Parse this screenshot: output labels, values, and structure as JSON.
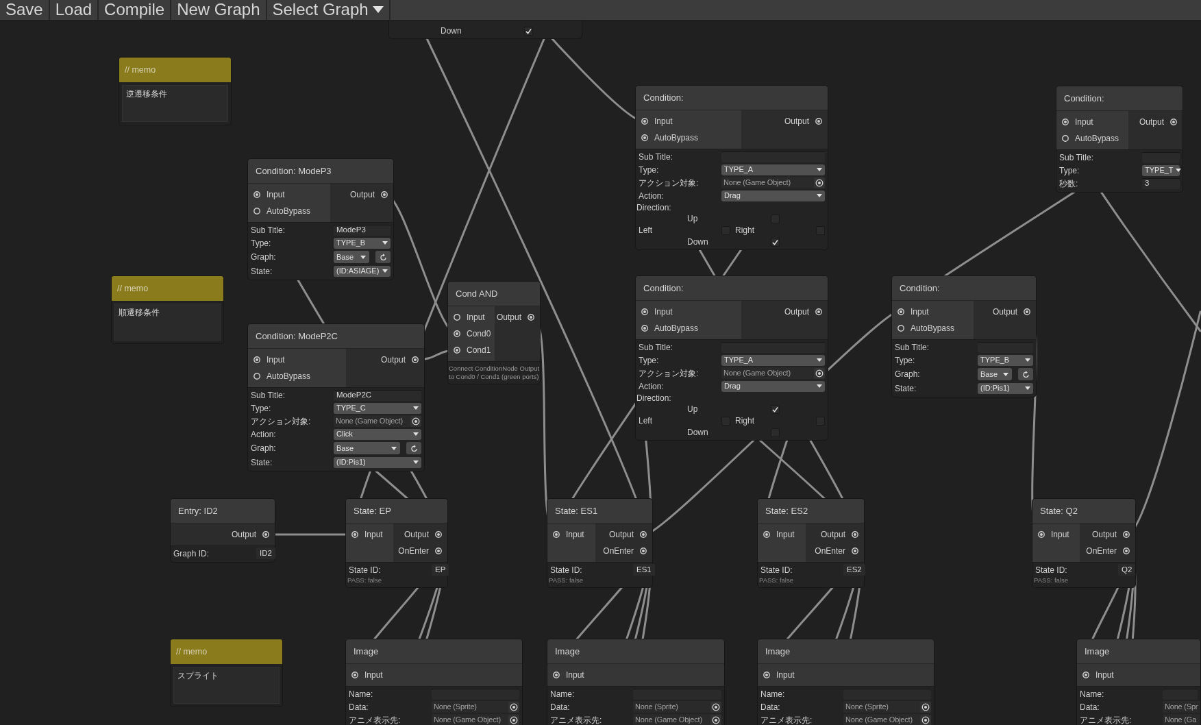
{
  "toolbar": {
    "buttons": [
      {
        "label": "Save",
        "kind": "button"
      },
      {
        "label": "Load",
        "kind": "button"
      },
      {
        "label": "Compile",
        "kind": "button"
      },
      {
        "label": "New Graph",
        "kind": "button"
      },
      {
        "label": "Select Graph",
        "kind": "dropdown"
      }
    ]
  },
  "nodes": [
    {
      "kind": "fragment",
      "fields": [
        {
          "kind": "check",
          "label": "Down",
          "checked": true
        }
      ]
    },
    {
      "kind": "memo",
      "title": "// memo",
      "text": "逆遷移条件"
    },
    {
      "kind": "node",
      "title": "Condition:",
      "inputs": [
        {
          "label": "Input",
          "connected": true
        },
        {
          "label": "AutoBypass",
          "connected": true
        }
      ],
      "outputs": [
        {
          "label": "Output",
          "connected": true
        }
      ],
      "fields": [
        {
          "kind": "text",
          "label": "Sub Title:"
        },
        {
          "kind": "dropdown",
          "label": "Type:",
          "value": "TYPE_A"
        },
        {
          "kind": "object",
          "label": "アクション対象:",
          "value": "None (Game Object)"
        },
        {
          "kind": "dropdown",
          "label": "Action:",
          "value": "Drag"
        },
        {
          "kind": "direction",
          "label": "Direction:",
          "options": [
            {
              "label": "Up",
              "checked": false
            },
            {
              "label": "Left",
              "checked": false
            },
            {
              "label": "Right",
              "checked": false
            },
            {
              "label": "Down",
              "checked": true
            }
          ]
        }
      ]
    },
    {
      "kind": "node",
      "title": "Condition:",
      "inputs": [
        {
          "label": "Input",
          "connected": true
        },
        {
          "label": "AutoBypass",
          "connected": false
        }
      ],
      "outputs": [
        {
          "label": "Output",
          "connected": true
        }
      ],
      "fields": [
        {
          "kind": "text",
          "label": "Sub Title:"
        },
        {
          "kind": "dropdown",
          "label": "Type:",
          "value": "TYPE_T"
        },
        {
          "kind": "text",
          "label": "秒数:",
          "value": "3"
        }
      ]
    },
    {
      "kind": "node",
      "title": "Condition: ModeP3",
      "inputs": [
        {
          "label": "Input",
          "connected": true
        },
        {
          "label": "AutoBypass",
          "connected": false
        }
      ],
      "outputs": [
        {
          "label": "Output",
          "connected": true
        }
      ],
      "fields": [
        {
          "kind": "text",
          "label": "Sub Title:",
          "value": "ModeP3"
        },
        {
          "kind": "dropdown",
          "label": "Type:",
          "value": "TYPE_B"
        },
        {
          "kind": "dropdown_reset",
          "label": "Graph:",
          "value": "Base"
        },
        {
          "kind": "dropdown",
          "label": "State:",
          "value": "(ID:ASIAGE)"
        }
      ]
    },
    {
      "kind": "memo",
      "title": "// memo",
      "text": "順遷移条件"
    },
    {
      "kind": "node",
      "title": "Cond AND",
      "inputs": [
        {
          "label": "Input",
          "connected": false
        },
        {
          "label": "Cond0",
          "connected": true
        },
        {
          "label": "Cond1",
          "connected": true
        }
      ],
      "outputs": [
        {
          "label": "Output",
          "connected": true
        }
      ],
      "note": [
        "Connect ConditionNode Output",
        "to Cond0 / Cond1 (green ports)"
      ]
    },
    {
      "kind": "node",
      "title": "Condition:",
      "inputs": [
        {
          "label": "Input",
          "connected": true
        },
        {
          "label": "AutoBypass",
          "connected": true
        }
      ],
      "outputs": [
        {
          "label": "Output",
          "connected": true
        }
      ],
      "fields": [
        {
          "kind": "text",
          "label": "Sub Title:"
        },
        {
          "kind": "dropdown",
          "label": "Type:",
          "value": "TYPE_A"
        },
        {
          "kind": "object",
          "label": "アクション対象:",
          "value": "None (Game Object)"
        },
        {
          "kind": "dropdown",
          "label": "Action:",
          "value": "Drag"
        },
        {
          "kind": "direction",
          "label": "Direction:",
          "options": [
            {
              "label": "Up",
              "checked": true
            },
            {
              "label": "Left",
              "checked": false
            },
            {
              "label": "Right",
              "checked": false
            },
            {
              "label": "Down",
              "checked": false
            }
          ]
        }
      ]
    },
    {
      "kind": "node",
      "title": "Condition:",
      "inputs": [
        {
          "label": "Input",
          "connected": true
        },
        {
          "label": "AutoBypass",
          "connected": false
        }
      ],
      "outputs": [
        {
          "label": "Output",
          "connected": true
        }
      ],
      "fields": [
        {
          "kind": "text",
          "label": "Sub Title:"
        },
        {
          "kind": "dropdown",
          "label": "Type:",
          "value": "TYPE_B"
        },
        {
          "kind": "dropdown_reset",
          "label": "Graph:",
          "value": "Base"
        },
        {
          "kind": "dropdown",
          "label": "State:",
          "value": "(ID:Pis1)"
        }
      ]
    },
    {
      "kind": "node",
      "title": "Condition: ModeP2C",
      "inputs": [
        {
          "label": "Input",
          "connected": true
        },
        {
          "label": "AutoBypass",
          "connected": false
        }
      ],
      "outputs": [
        {
          "label": "Output",
          "connected": true
        }
      ],
      "fields": [
        {
          "kind": "text",
          "label": "Sub Title:",
          "value": "ModeP2C"
        },
        {
          "kind": "dropdown",
          "label": "Type:",
          "value": "TYPE_C"
        },
        {
          "kind": "object",
          "label": "アクション対象:",
          "value": "None (Game Object)"
        },
        {
          "kind": "dropdown",
          "label": "Action:",
          "value": "Click"
        },
        {
          "kind": "dropdown_reset",
          "label": "Graph:",
          "value": "Base"
        },
        {
          "kind": "dropdown",
          "label": "State:",
          "value": "(ID:Pis1)"
        }
      ]
    },
    {
      "kind": "node",
      "title": "Entry: ID2",
      "outputs": [
        {
          "label": "Output",
          "connected": true
        }
      ],
      "fields": [
        {
          "kind": "id",
          "label": "Graph ID:",
          "value": "ID2"
        }
      ]
    },
    {
      "kind": "node",
      "title": "State: EP",
      "inputs": [
        {
          "label": "Input",
          "connected": true
        }
      ],
      "outputs": [
        {
          "label": "Output",
          "connected": true
        },
        {
          "label": "OnEnter",
          "connected": true
        }
      ],
      "fields": [
        {
          "kind": "id",
          "label": "State ID:",
          "value": "EP"
        },
        {
          "kind": "status",
          "text": "PASS: false"
        }
      ]
    },
    {
      "kind": "node",
      "title": "State: ES1",
      "inputs": [
        {
          "label": "Input",
          "connected": true
        }
      ],
      "outputs": [
        {
          "label": "Output",
          "connected": true
        },
        {
          "label": "OnEnter",
          "connected": true
        }
      ],
      "fields": [
        {
          "kind": "id",
          "label": "State ID:",
          "value": "ES1"
        },
        {
          "kind": "status",
          "text": "PASS: false"
        }
      ]
    },
    {
      "kind": "node",
      "title": "State: ES2",
      "inputs": [
        {
          "label": "Input",
          "connected": true
        }
      ],
      "outputs": [
        {
          "label": "Output",
          "connected": true
        },
        {
          "label": "OnEnter",
          "connected": true
        }
      ],
      "fields": [
        {
          "kind": "id",
          "label": "State ID:",
          "value": "ES2"
        },
        {
          "kind": "status",
          "text": "PASS: false"
        }
      ]
    },
    {
      "kind": "node",
      "title": "State: Q2",
      "inputs": [
        {
          "label": "Input",
          "connected": true
        }
      ],
      "outputs": [
        {
          "label": "Output",
          "connected": true
        },
        {
          "label": "OnEnter",
          "connected": true
        }
      ],
      "fields": [
        {
          "kind": "id",
          "label": "State ID:",
          "value": "Q2"
        },
        {
          "kind": "status",
          "text": "PASS: false"
        }
      ]
    },
    {
      "kind": "memo",
      "title": "// memo",
      "text": "スプライト"
    },
    {
      "kind": "node",
      "title": "Image",
      "inputs": [
        {
          "label": "Input",
          "connected": true
        }
      ],
      "fields": [
        {
          "kind": "text",
          "label": "Name:"
        },
        {
          "kind": "object",
          "label": "Data:",
          "value": "None (Sprite)"
        },
        {
          "kind": "object",
          "label": "アニメ表示先:",
          "value": "None (Game Object)"
        }
      ]
    },
    {
      "kind": "node",
      "title": "Image",
      "inputs": [
        {
          "label": "Input",
          "connected": true
        }
      ],
      "fields": [
        {
          "kind": "text",
          "label": "Name:"
        },
        {
          "kind": "object",
          "label": "Data:",
          "value": "None (Sprite)"
        },
        {
          "kind": "object",
          "label": "アニメ表示先:",
          "value": "None (Game Object)"
        }
      ]
    },
    {
      "kind": "node",
      "title": "Image",
      "inputs": [
        {
          "label": "Input",
          "connected": true
        }
      ],
      "fields": [
        {
          "kind": "text",
          "label": "Name:"
        },
        {
          "kind": "object",
          "label": "Data:",
          "value": "None (Sprite)"
        },
        {
          "kind": "object",
          "label": "アニメ表示先:",
          "value": "None (Game Object)"
        }
      ]
    },
    {
      "kind": "node",
      "title": "Image",
      "inputs": [
        {
          "label": "Input",
          "connected": true
        }
      ],
      "fields": [
        {
          "kind": "text",
          "label": "Name:"
        },
        {
          "kind": "object_clipped",
          "label": "Data:",
          "value": "None (Spr"
        },
        {
          "kind": "object_clipped",
          "label": "アニメ表示先:",
          "value": "None (Ga"
        }
      ]
    }
  ]
}
